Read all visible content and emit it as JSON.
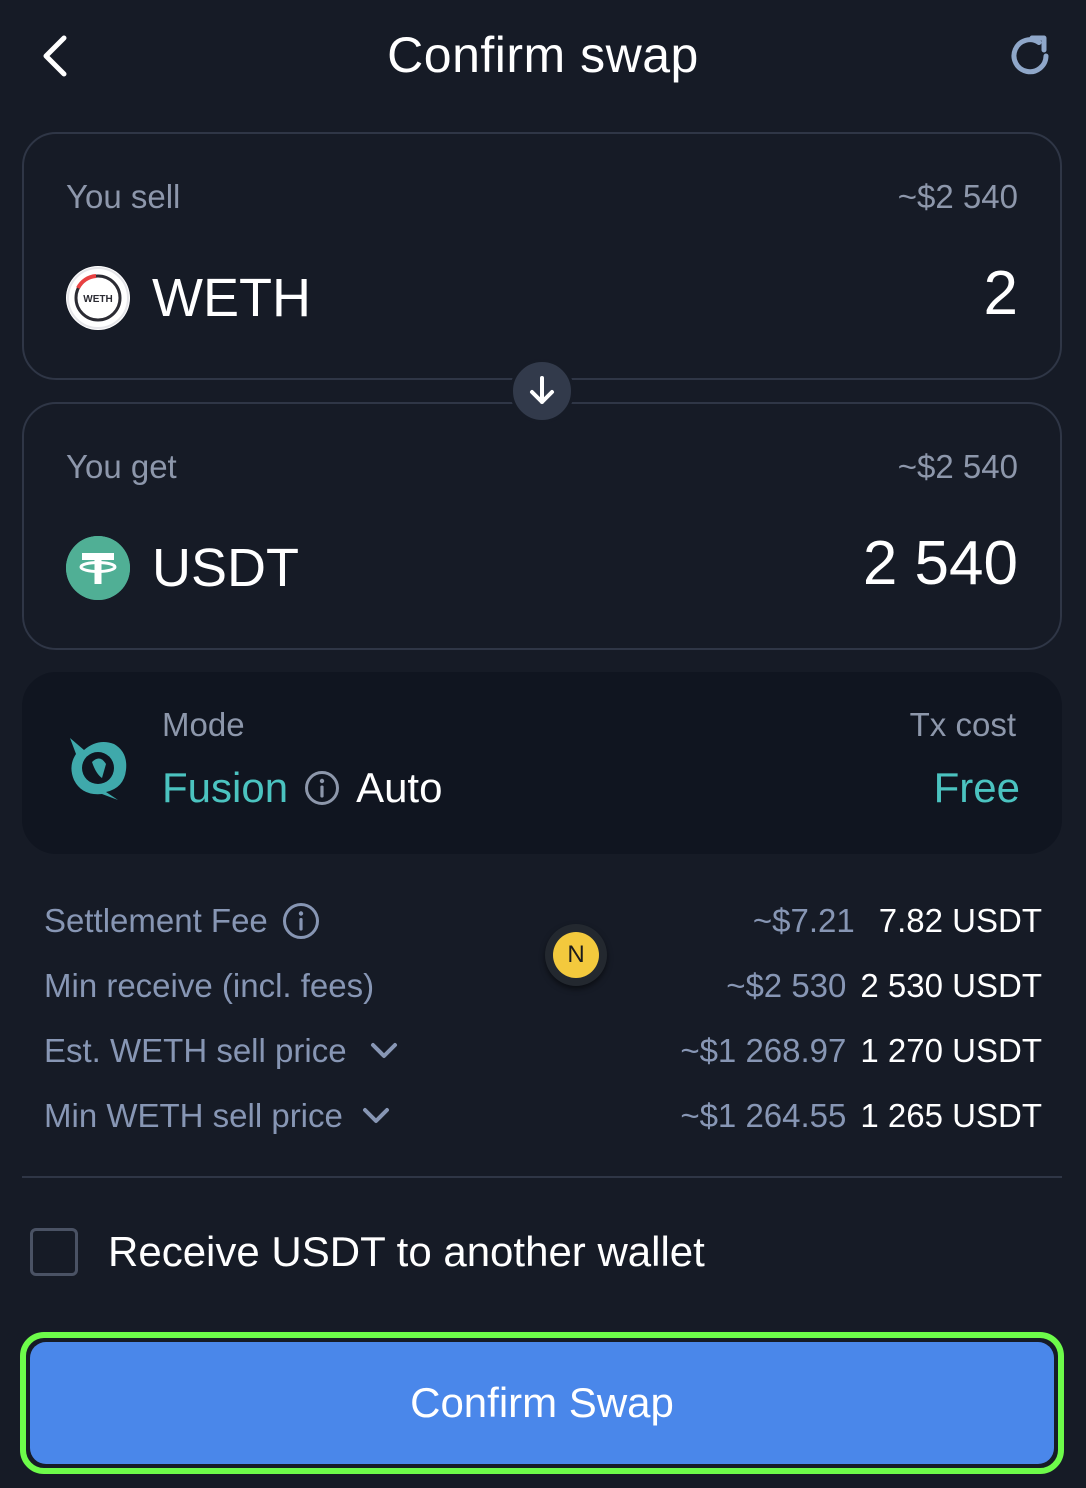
{
  "header": {
    "title": "Confirm swap",
    "back_icon": "chevron-left-icon",
    "refresh_icon": "refresh-icon"
  },
  "sell": {
    "label": "You sell",
    "usd_value": "~$2 540",
    "token_symbol": "WETH",
    "token_icon_text": "WETH",
    "amount": "2"
  },
  "switch": {
    "icon": "arrow-down-icon"
  },
  "get": {
    "label": "You get",
    "usd_value": "~$2 540",
    "token_symbol": "USDT",
    "amount": "2 540"
  },
  "mode": {
    "label": "Mode",
    "mode_name": "Fusion",
    "mode_setting": "Auto",
    "tx_cost_label": "Tx cost",
    "tx_cost_value": "Free"
  },
  "details": {
    "settlement_fee": {
      "label": "Settlement Fee",
      "usd": "~$7.21",
      "value": "7.82 USDT"
    },
    "min_receive": {
      "label": "Min receive (incl. fees)",
      "usd": "~$2 530",
      "value": "2 530 USDT"
    },
    "est_sell_price": {
      "label": "Est. WETH sell price",
      "usd": "~$1 268.97",
      "value": "1 270 USDT"
    },
    "min_sell_price": {
      "label": "Min WETH sell price",
      "usd": "~$1 264.55",
      "value": "1 265 USDT"
    }
  },
  "badge": {
    "letter": "N"
  },
  "receive_other": {
    "label": "Receive USDT to another wallet",
    "checked": false
  },
  "confirm_button": {
    "label": "Confirm Swap"
  },
  "colors": {
    "background": "#161b26",
    "accent_teal": "#4bc3c0",
    "primary_button": "#4a87ea",
    "highlight_outline": "#6dfb4a",
    "muted_text": "#8d97ab"
  }
}
